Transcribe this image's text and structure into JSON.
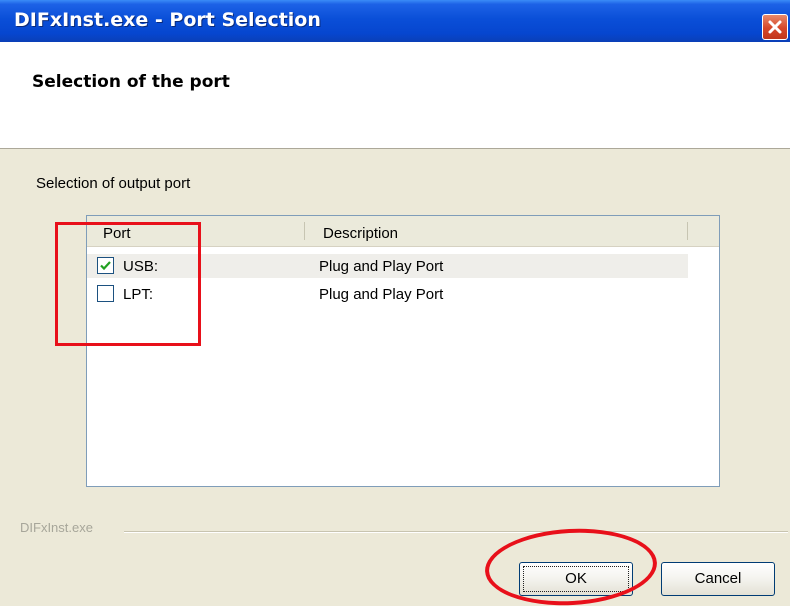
{
  "window": {
    "title": "DIFxInst.exe - Port Selection",
    "close_icon": "close-icon"
  },
  "header": {
    "title": "Selection of the port"
  },
  "section": {
    "label": "Selection of output port"
  },
  "list": {
    "columns": [
      "Port",
      "Description"
    ],
    "rows": [
      {
        "port": "USB:",
        "description": "Plug and Play Port",
        "checked": true,
        "selected": true
      },
      {
        "port": "LPT:",
        "description": "Plug and Play Port",
        "checked": false,
        "selected": false
      }
    ]
  },
  "footer": {
    "label": "DIFxInst.exe"
  },
  "buttons": {
    "ok": "OK",
    "cancel": "Cancel"
  },
  "colors": {
    "titlebar": "#0a4fd8",
    "annotation": "#e8101a",
    "dialog_bg": "#ECE9D8"
  }
}
